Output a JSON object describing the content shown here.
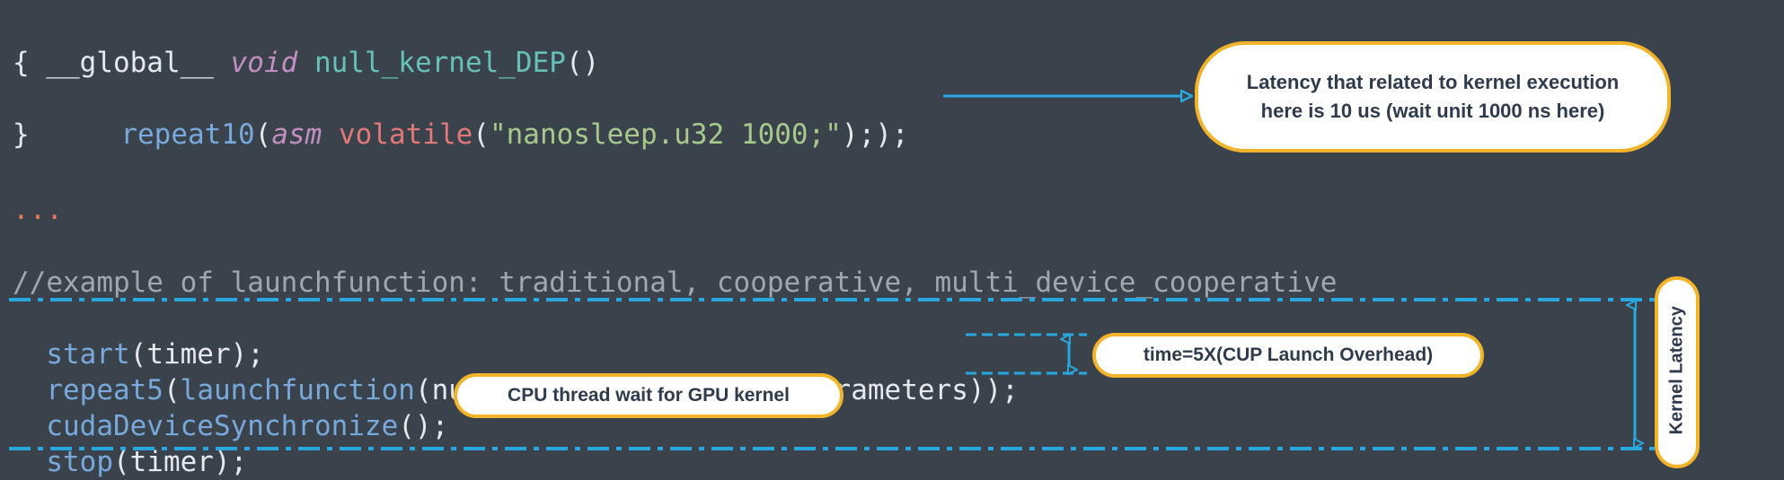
{
  "code": {
    "line1": {
      "global": "__global__",
      "void": "void",
      "fn": "null_kernel_DEP",
      "parens": "()"
    },
    "line2": "{",
    "line3": {
      "call": "repeat10",
      "open": "(",
      "asm": "asm",
      "volatile": "volatile",
      "popen": "(",
      "str": "\"nanosleep.u32 1000;\"",
      "close": ");)",
      "tail": ";"
    },
    "line4": "}",
    "ellipsis": "...",
    "comment": "//example of launchfunction: traditional, cooperative, multi_device_cooperative",
    "start": {
      "fn": "start",
      "args": "(timer);"
    },
    "repeat5": {
      "fn1": "repeat5",
      "p1": "(",
      "fn2": "launchfunction",
      "p2": "(null_kernel_DEP,launchparameters));"
    },
    "sync": {
      "fn": "cudaDeviceSynchronize",
      "args": "();"
    },
    "stop": {
      "fn": "stop",
      "args": "(timer);"
    }
  },
  "callouts": {
    "latency_line1": "Latency that related to kernel execution",
    "latency_line2": "here is 10 us (wait unit 1000 ns here)",
    "launch_overhead": "time=5X(CUP Launch Overhead)",
    "cpu_wait": "CPU thread wait for GPU kernel",
    "kernel_latency": "Kernel Latency"
  },
  "colors": {
    "background": "#3a424c",
    "callout_border": "#f3b42a",
    "arrow_blue": "#29a8e0"
  }
}
